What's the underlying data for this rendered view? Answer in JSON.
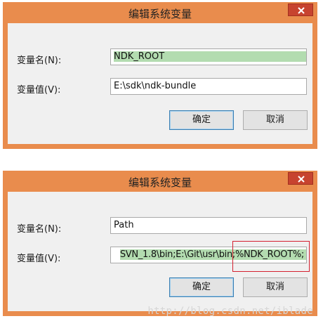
{
  "dialog_top": {
    "title": "编辑系统变量",
    "name_label": "变量名(N):",
    "name_value": "NDK_ROOT",
    "value_label": "变量值(V):",
    "value_value": "E:\\sdk\\ndk-bundle",
    "ok_label": "确定",
    "cancel_label": "取消"
  },
  "dialog_bottom": {
    "title": "编辑系统变量",
    "name_label": "变量名(N):",
    "name_value": "Path",
    "value_label": "变量值(V):",
    "value_value": "SVN_1.8\\bin;E:\\Git\\usr\\bin;%NDK_ROOT%;",
    "ok_label": "确定",
    "cancel_label": "取消"
  },
  "watermark": "http://blog.csdn.net/iblade",
  "colors": {
    "titlebar": "#e98c4d",
    "close_button": "#c7432f",
    "selection": "#b3dcb0",
    "highlight_box": "#d4202f"
  }
}
